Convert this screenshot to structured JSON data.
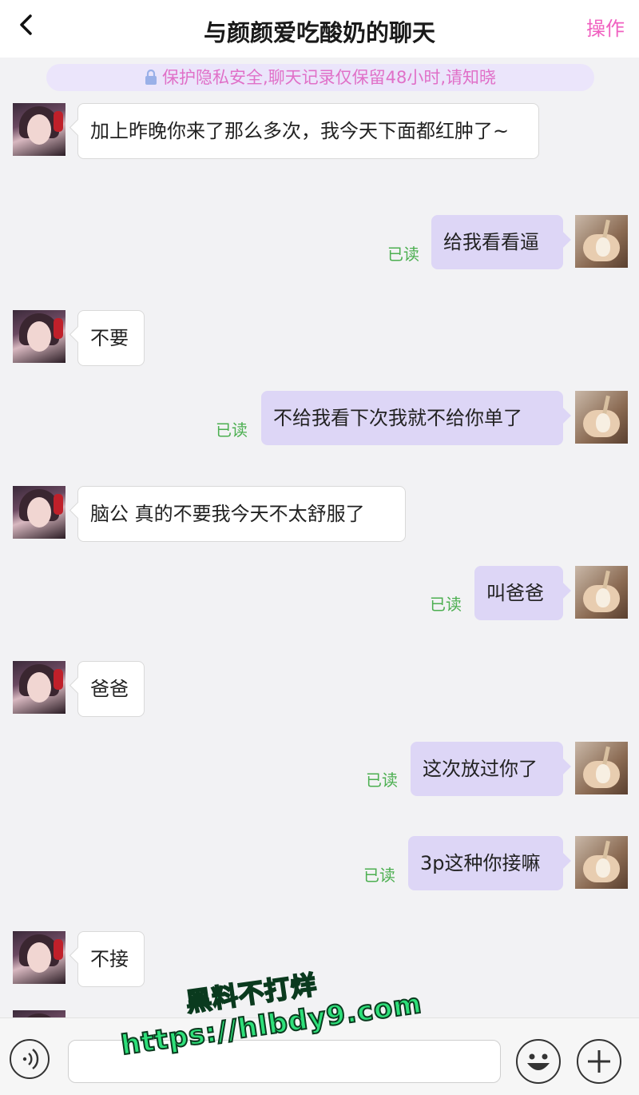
{
  "header": {
    "back_icon": "chevron-left-icon",
    "title": "与颜颜爱吃酸奶的聊天",
    "action_label": "操作"
  },
  "notice": {
    "text": "保护隐私安全,聊天记录仅保留48小时,请知晓",
    "icon": "lock-icon"
  },
  "messages": [
    {
      "side": "left",
      "text": "加上昨晚你来了那么多次，我今天下面都红肿了~"
    },
    {
      "side": "right",
      "text": "给我看看逼",
      "status": "已读"
    },
    {
      "side": "left",
      "text": "不要"
    },
    {
      "side": "right",
      "text": "不给我看下次我就不给你单了",
      "status": "已读"
    },
    {
      "side": "left",
      "text": "脑公 真的不要我今天不太舒服了"
    },
    {
      "side": "right",
      "text": "叫爸爸",
      "status": "已读"
    },
    {
      "side": "left",
      "text": "爸爸"
    },
    {
      "side": "right",
      "text": "这次放过你了",
      "status": "已读"
    },
    {
      "side": "right",
      "text": "3p这种你接嘛",
      "status": "已读"
    },
    {
      "side": "left",
      "text": "不接"
    }
  ],
  "footer": {
    "voice_icon": "voice-icon",
    "emoji_icon": "emoji-icon",
    "plus_icon": "plus-icon",
    "input_value": ""
  },
  "watermark": {
    "line1": "黑料不打烊",
    "line2": "https://hlbdy9.com"
  },
  "colors": {
    "accent": "#f060c0",
    "bubble_self": "#ddd6f6",
    "read_status": "#4caf50",
    "notice_bg": "#ebe5fb"
  }
}
